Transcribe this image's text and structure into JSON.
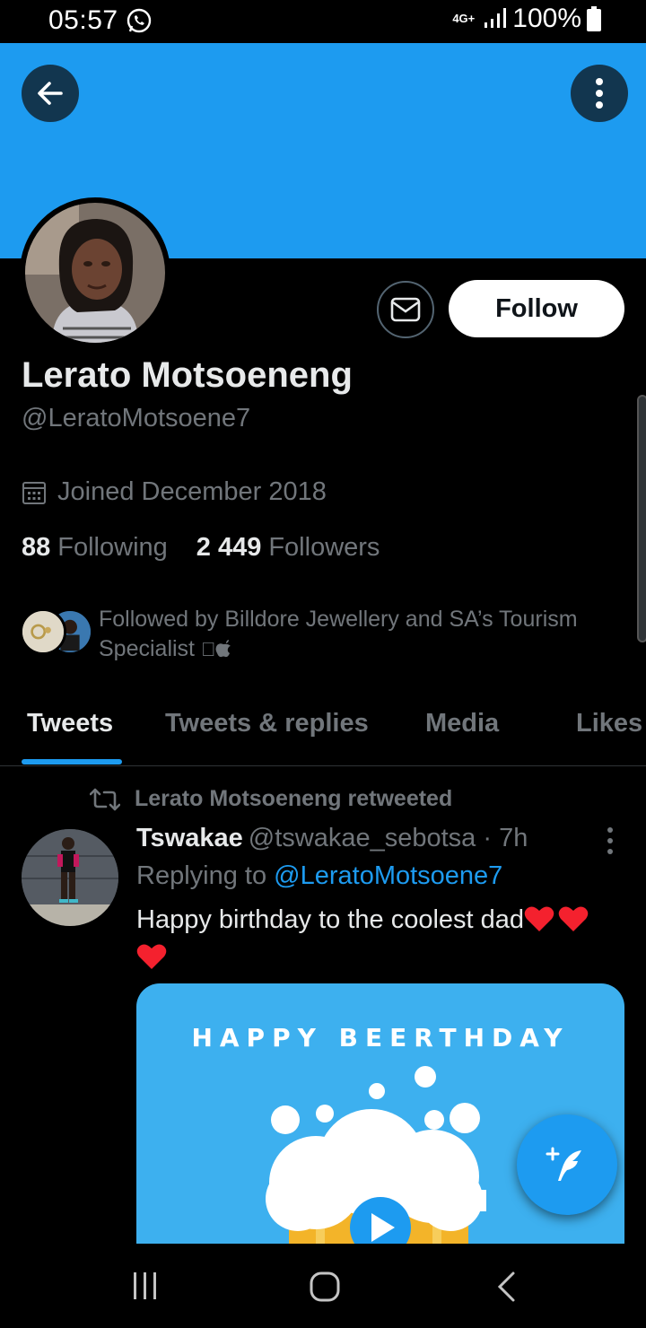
{
  "status_bar": {
    "time": "05:57",
    "network": "4G+",
    "battery": "100%"
  },
  "profile": {
    "name": "Lerato Motsoeneng",
    "handle": "@LeratoMotsoene7",
    "joined": "Joined December 2018",
    "following_count": "88",
    "following_label": "Following",
    "followers_count": "2 449",
    "followers_label": "Followers",
    "followed_by": "Followed by Billdore Jewellery and SA’s Tourism Specialist",
    "follow_label": "Follow"
  },
  "tabs": [
    {
      "label": "Tweets",
      "active": true
    },
    {
      "label": "Tweets & replies",
      "active": false
    },
    {
      "label": "Media",
      "active": false
    },
    {
      "label": "Likes",
      "active": false
    }
  ],
  "tweet": {
    "retweet_context": "Lerato Motsoeneng retweeted",
    "author": "Tswakae",
    "handle": "@tswakae_sebotsa",
    "time": "· 7h",
    "replying_prefix": "Replying to",
    "replying_to": "@LeratoMotsoene7",
    "text": "Happy birthday to the coolest dad",
    "media_title": "HAPPY BEERTHDAY"
  },
  "colors": {
    "accent": "#1d9bf0",
    "background": "#000000",
    "heart": "#f4212e"
  }
}
